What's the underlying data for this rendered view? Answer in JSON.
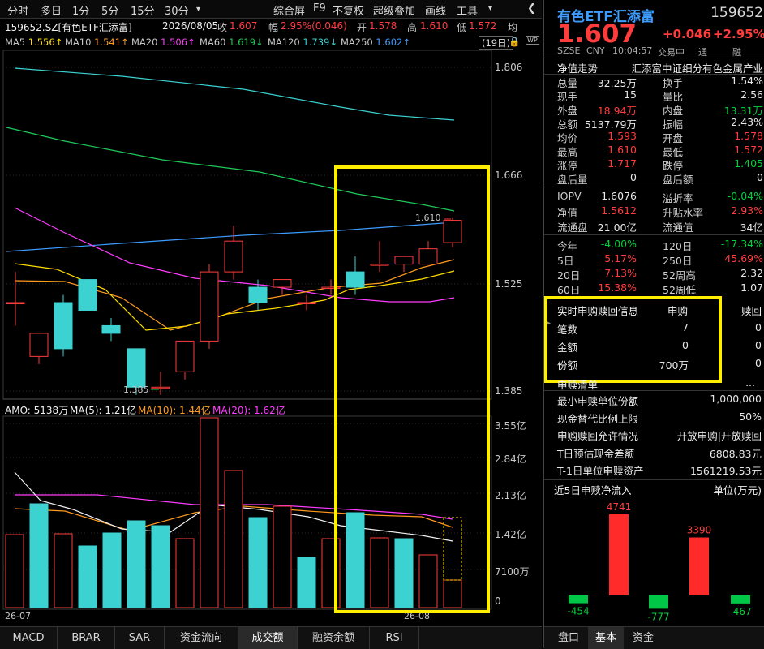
{
  "toolbar": {
    "left_tabs": [
      "分时",
      "多日",
      "1分",
      "5分",
      "15分",
      "30分",
      "▾"
    ],
    "right_items": [
      "综合屏",
      "F9",
      "不复权",
      "超级叠加",
      "画线",
      "工具"
    ],
    "chevron": "❮"
  },
  "info": {
    "security": "159652.SZ[有色ETF汇添富]",
    "date": "2026/08/05",
    "close_label": "收",
    "close": "1.607",
    "range_label": "幅",
    "range": "2.95%(0.046)",
    "open_label": "开",
    "open": "1.578",
    "high_label": "高",
    "high": "1.610",
    "low_label": "低",
    "low": "1.572",
    "avg_label": "均",
    "period": "(19日)"
  },
  "ma": [
    {
      "label": "MA5",
      "value": "1.556↑",
      "color": "#ffdc00"
    },
    {
      "label": "MA10",
      "value": "1.541↑",
      "color": "#ff9a1e"
    },
    {
      "label": "MA20",
      "value": "1.506↑",
      "color": "#ff3cff"
    },
    {
      "label": "MA60",
      "value": "1.619↓",
      "color": "#1ecc5a"
    },
    {
      "label": "MA120",
      "value": "1.739↓",
      "color": "#3cd2d2"
    },
    {
      "label": "MA250",
      "value": "1.602↑",
      "color": "#3c9cff"
    }
  ],
  "price_axis": [
    "1.806",
    "1.666",
    "1.525",
    "1.385"
  ],
  "candle_labels": {
    "high_marker": "1.610",
    "low_marker": "1.385"
  },
  "amo": {
    "label": "AMO: 5138万",
    "ma5": "MA(5): 1.21亿",
    "ma10": "MA(10): 1.44亿",
    "ma20": "MA(20): 1.62亿"
  },
  "vol_axis": [
    "3.55亿",
    "2.84亿",
    "2.13亿",
    "1.42亿",
    "7100万",
    "0"
  ],
  "date_labels": {
    "left": "26-07",
    "right": "26-08"
  },
  "bottom_tabs": [
    "MACD",
    "BRAR",
    "SAR",
    "资金流向",
    "成交额",
    "融资余额",
    "RSI"
  ],
  "bottom_active": "成交额",
  "right": {
    "name": "有色ETF汇添富",
    "code": "159652",
    "price": "1.607",
    "change": "+0.046",
    "change_pct": "+2.95%",
    "sub": [
      "SZSE",
      "CNY",
      "10:04:57",
      "交易中",
      "通",
      "融"
    ],
    "nav_trend": "净值走势",
    "index_name": "汇添富中证细分有色金属产业",
    "stats": [
      [
        "总量",
        "32.25万",
        "换手",
        "1.54%"
      ],
      [
        "现手",
        "15",
        "量比",
        "2.56"
      ],
      [
        "外盘",
        "18.94万",
        "内盘",
        "13.31万"
      ],
      [
        "总额",
        "5137.79万",
        "振幅",
        "2.43%"
      ],
      [
        "均价",
        "1.593",
        "开盘",
        "1.578"
      ],
      [
        "最高",
        "1.610",
        "最低",
        "1.572"
      ],
      [
        "涨停",
        "1.717",
        "跌停",
        "1.405"
      ],
      [
        "盘后量",
        "0",
        "盘后额",
        "0"
      ]
    ],
    "stats2": [
      [
        "IOPV",
        "1.6076",
        "溢折率",
        "-0.04%"
      ],
      [
        "净值",
        "1.5612",
        "升贴水率",
        "2.93%"
      ],
      [
        "流通盘",
        "21.00亿",
        "流通值",
        "34亿"
      ]
    ],
    "stats3": [
      [
        "今年",
        "-4.00%",
        "120日",
        "-17.34%"
      ],
      [
        "5日",
        "5.17%",
        "250日",
        "45.69%"
      ],
      [
        "20日",
        "7.13%",
        "52周高",
        "2.32"
      ],
      [
        "60日",
        "15.38%",
        "52周低",
        "1.07"
      ]
    ],
    "sub_header": [
      "实时申购赎回信息",
      "申购",
      "赎回"
    ],
    "sub_rows": [
      [
        "笔数",
        "7",
        "0"
      ],
      [
        "金额",
        "0",
        "0"
      ],
      [
        "份额",
        "700万",
        "0"
      ]
    ],
    "list_header": "申赎清单",
    "list_dots": "...",
    "list_rows": [
      [
        "最小申赎单位份额",
        "1,000,000"
      ],
      [
        "现金替代比例上限",
        "50%"
      ],
      [
        "申购赎回允许情况",
        "开放申购|开放赎回"
      ],
      [
        "T日预估现金差额",
        "6808.83元"
      ],
      [
        "T-1日单位申赎资产",
        "1561219.53元"
      ]
    ],
    "flow_title": "近5日申赎净流入",
    "flow_unit": "单位(万元)",
    "flow_values": [
      -454,
      4741,
      -777,
      3390,
      -467
    ],
    "flow_labels": [
      "-454",
      "4741",
      "-777",
      "3390",
      "-467"
    ],
    "tabs": [
      "盘口",
      "基本",
      "资金"
    ],
    "active_tab": "基本"
  }
}
